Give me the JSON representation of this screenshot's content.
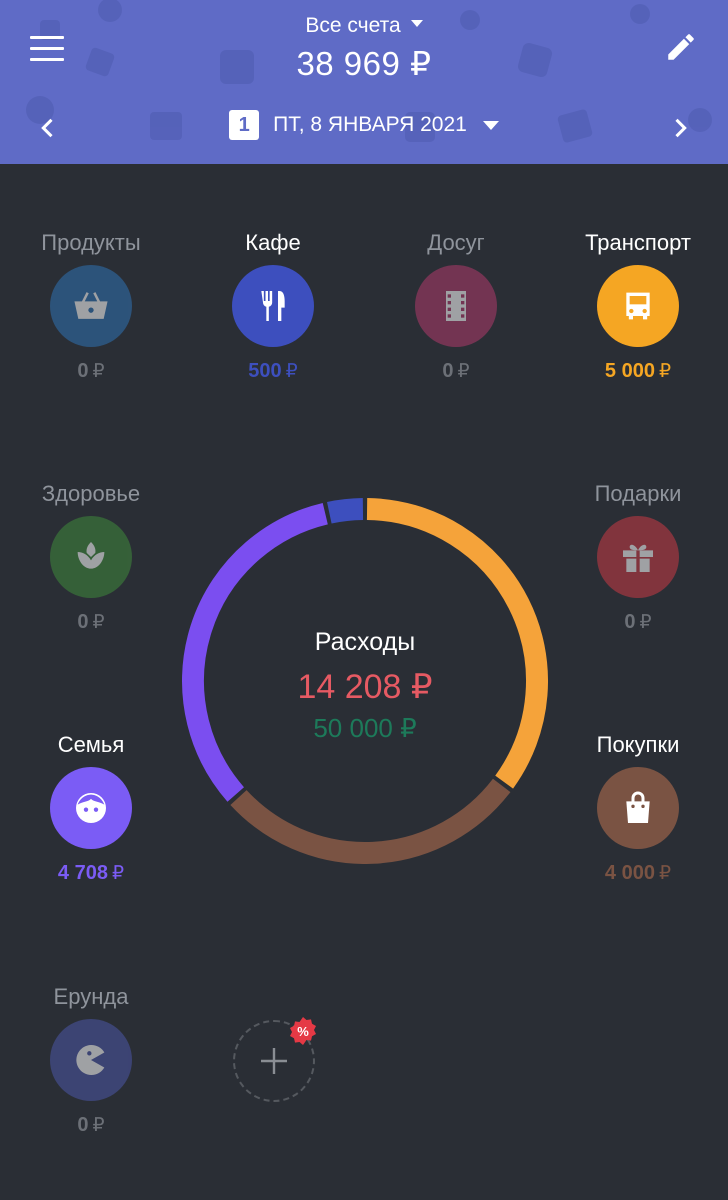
{
  "header": {
    "account_title": "Все счета",
    "balance": "38 969 ₽",
    "day_number": "1",
    "date": "ПТ, 8 ЯНВАРЯ 2021",
    "bg_color": "#5f6bc6"
  },
  "categories": [
    {
      "name": "Продукты",
      "amount": "0",
      "currency": "₽",
      "color": "#2f72b3",
      "icon": "basket-icon"
    },
    {
      "name": "Кафе",
      "amount": "500",
      "currency": "₽",
      "color": "#3d4fbe",
      "icon": "fork-knife-icon"
    },
    {
      "name": "Досуг",
      "amount": "0",
      "currency": "₽",
      "color": "#b03a6b",
      "icon": "film-icon"
    },
    {
      "name": "Транспорт",
      "amount": "5 000",
      "currency": "₽",
      "color": "#f5a623",
      "icon": "bus-icon"
    },
    {
      "name": "Здоровье",
      "amount": "0",
      "currency": "₽",
      "color": "#3f8a3c",
      "icon": "leaf-icon"
    },
    {
      "name": "Подарки",
      "amount": "0",
      "currency": "₽",
      "color": "#c83a45",
      "icon": "gift-icon"
    },
    {
      "name": "Семья",
      "amount": "4 708",
      "currency": "₽",
      "color": "#7b5cf5",
      "icon": "face-icon"
    },
    {
      "name": "Покупки",
      "amount": "4 000",
      "currency": "₽",
      "color": "#7a5343",
      "icon": "shopping-bag-icon"
    },
    {
      "name": "Ерунда",
      "amount": "0",
      "currency": "₽",
      "color": "#4b56a6",
      "icon": "pacman-icon"
    }
  ],
  "summary": {
    "label": "Расходы",
    "spent": "14 208 ₽",
    "budget": "50 000 ₽"
  },
  "ring_segments": [
    {
      "category": "Транспорт",
      "value": 5000,
      "color": "#f5a33a"
    },
    {
      "category": "Покупки",
      "value": 4000,
      "color": "#7a5343"
    },
    {
      "category": "Семья",
      "value": 4708,
      "color": "#7b4ef0"
    },
    {
      "category": "Кафе",
      "value": 500,
      "color": "#3d4fbe"
    }
  ],
  "add_badge": "%"
}
